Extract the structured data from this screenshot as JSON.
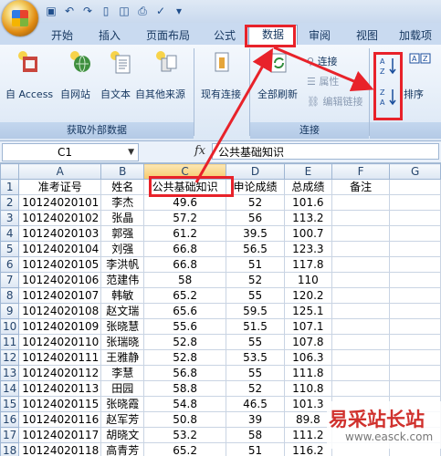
{
  "tabs": [
    "开始",
    "插入",
    "页面布局",
    "公式",
    "数据",
    "审阅",
    "视图",
    "加载项"
  ],
  "active_tab": "数据",
  "ribbon": {
    "group_external": {
      "label": "获取外部数据",
      "buttons": [
        "自 Access",
        "自网站",
        "自文本",
        "自其他来源",
        "现有连接"
      ]
    },
    "group_connections": {
      "label": "连接",
      "refresh": "全部刷新",
      "connect": "连接",
      "properties": "属性",
      "edit_links": "编辑链接"
    },
    "group_sort": {
      "sort_label": "排序",
      "az": "A↓Z",
      "za": "Z↓A"
    }
  },
  "formula_bar": {
    "name_box": "C1",
    "fx": "fx",
    "content": "公共基础知识"
  },
  "columns": [
    "A",
    "B",
    "C",
    "D",
    "E",
    "F",
    "G"
  ],
  "header_row": [
    "准考证号",
    "姓名",
    "公共基础知识",
    "申论成绩",
    "总成绩",
    "备注"
  ],
  "rows": [
    [
      "10124020101",
      "李杰",
      "49.6",
      "52",
      "101.6"
    ],
    [
      "10124020102",
      "张晶",
      "57.2",
      "56",
      "113.2"
    ],
    [
      "10124020103",
      "郭强",
      "61.2",
      "39.5",
      "100.7"
    ],
    [
      "10124020104",
      "刘强",
      "66.8",
      "56.5",
      "123.3"
    ],
    [
      "10124020105",
      "李洪帆",
      "66.8",
      "51",
      "117.8"
    ],
    [
      "10124020106",
      "范建伟",
      "58",
      "52",
      "110"
    ],
    [
      "10124020107",
      "韩敏",
      "65.2",
      "55",
      "120.2"
    ],
    [
      "10124020108",
      "赵文瑞",
      "65.6",
      "59.5",
      "125.1"
    ],
    [
      "10124020109",
      "张晓慧",
      "55.6",
      "51.5",
      "107.1"
    ],
    [
      "10124020110",
      "张瑞晓",
      "52.8",
      "55",
      "107.8"
    ],
    [
      "10124020111",
      "王雅静",
      "52.8",
      "53.5",
      "106.3"
    ],
    [
      "10124020112",
      "李慧",
      "56.8",
      "55",
      "111.8"
    ],
    [
      "10124020113",
      "田园",
      "58.8",
      "52",
      "110.8"
    ],
    [
      "10124020115",
      "张晓霞",
      "54.8",
      "46.5",
      "101.3"
    ],
    [
      "10124020116",
      "赵军芳",
      "50.8",
      "39",
      "89.8"
    ],
    [
      "10124020117",
      "胡晓文",
      "53.2",
      "58",
      "111.2"
    ],
    [
      "10124020118",
      "高青芳",
      "65.2",
      "51",
      "116.2"
    ]
  ],
  "watermark": {
    "cn": "易采站长站",
    "en": "www.easck.com"
  },
  "colors": {
    "highlight": "#e8222a",
    "ribbon": "#dbe7f5"
  }
}
